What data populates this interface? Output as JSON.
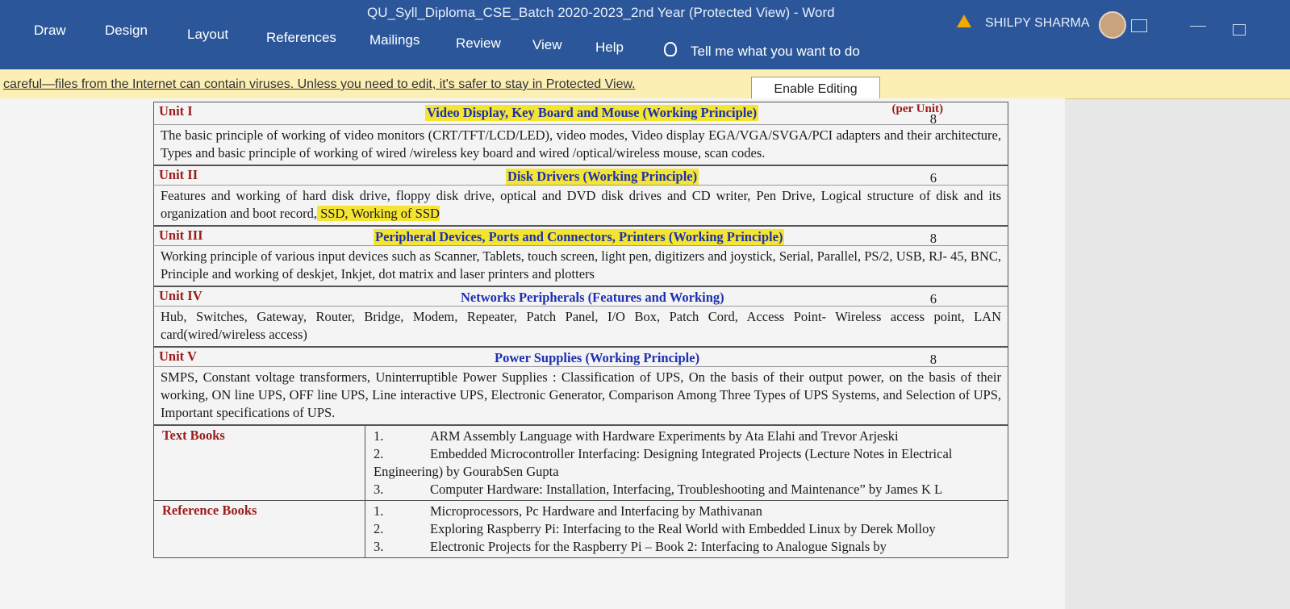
{
  "window": {
    "title": "QU_Syll_Diploma_CSE_Batch 2020-2023_2nd Year (Protected View)  -  Word",
    "user": "SHILPY SHARMA"
  },
  "ribbon": {
    "tabs": [
      "Draw",
      "Design",
      "Layout",
      "References",
      "Mailings",
      "Review",
      "View",
      "Help"
    ],
    "tell_me": "Tell me what you want to do"
  },
  "protected_view": {
    "message": "careful—files from the Internet can contain viruses. Unless you need to edit, it's safer to stay in Protected View.",
    "button": "Enable Editing"
  },
  "document": {
    "units": [
      {
        "label": "Unit I",
        "title": "Video Display, Key Board and Mouse (Working Principle)",
        "per_unit": "(per Unit)",
        "hours": "8",
        "body": "The basic principle of working of video monitors (CRT/TFT/LCD/LED), video modes, Video display EGA/VGA/SVGA/PCI adapters and their architecture, Types and basic principle of working of wired /wireless key board and wired /optical/wireless mouse, scan codes.",
        "highlight": ""
      },
      {
        "label": "Unit II",
        "title": "Disk Drivers (Working Principle)",
        "per_unit": "",
        "hours": "6",
        "body": "Features and working of hard disk drive, floppy disk drive, optical and DVD disk drives and CD writer, Pen Drive, Logical structure of disk and its organization and boot record,",
        "highlight": " SSD, Working of SSD"
      },
      {
        "label": "Unit III",
        "title": "Peripheral Devices, Ports and Connectors, Printers (Working Principle)",
        "per_unit": "",
        "hours": "8",
        "body": "Working principle of various input devices such as Scanner, Tablets, touch screen, light pen, digitizers and joystick, Serial, Parallel, PS/2, USB, RJ- 45, BNC, Principle and working of deskjet, Inkjet, dot matrix and laser printers and plotters",
        "highlight": ""
      },
      {
        "label": "Unit IV",
        "title": "Networks Peripherals (Features and Working)",
        "per_unit": "",
        "hours": "6",
        "body": "Hub, Switches, Gateway, Router, Bridge, Modem, Repeater, Patch Panel, I/O Box, Patch Cord, Access Point- Wireless access point, LAN card(wired/wireless access)",
        "highlight": ""
      },
      {
        "label": "Unit V",
        "title": "Power Supplies (Working Principle)",
        "per_unit": "",
        "hours": "8",
        "body": "SMPS, Constant voltage transformers, Uninterruptible Power Supplies : Classification of UPS, On the basis of their output power, on the basis of their working, ON line UPS, OFF line UPS, Line interactive UPS, Electronic Generator, Comparison Among Three Types of UPS Systems, and Selection of UPS, Important specifications of UPS.",
        "highlight": ""
      }
    ],
    "text_books": {
      "label": "Text Books",
      "items": [
        {
          "n": "1.",
          "text": "ARM Assembly Language with Hardware Experiments by Ata Elahi and Trevor Arjeski"
        },
        {
          "n": "2.",
          "text": "Embedded Microcontroller Interfacing: Designing Integrated Projects (Lecture Notes in Electrical Engineering) by GourabSen Gupta"
        },
        {
          "n": "3.",
          "text": "Computer Hardware: Installation, Interfacing, Troubleshooting and Maintenance” by James K L"
        }
      ]
    },
    "reference_books": {
      "label": "Reference Books",
      "items": [
        {
          "n": "1.",
          "text": "Microprocessors, Pc Hardware and Interfacing by Mathivanan"
        },
        {
          "n": "2.",
          "text": "Exploring Raspberry Pi: Interfacing to the Real World with Embedded Linux by Derek Molloy"
        },
        {
          "n": "3.",
          "text": "Electronic Projects for the Raspberry Pi – Book 2: Interfacing to Analogue Signals by"
        }
      ]
    }
  }
}
